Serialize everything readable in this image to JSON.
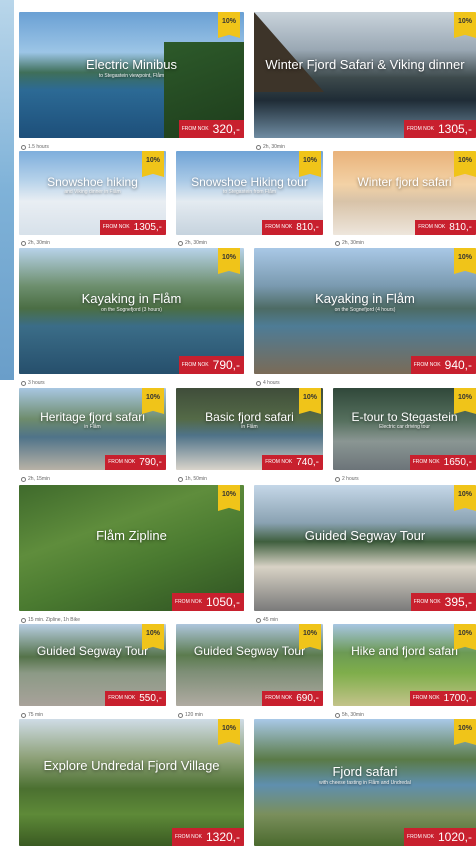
{
  "tiles": [
    {
      "title": "Electric Minibus",
      "subtitle": "to Stegastein viewpoint, Flåm",
      "badge": "10%",
      "from": "From NOK",
      "price": "320,-",
      "duration": "1.5 hours"
    },
    {
      "title": "Winter Fjord Safari & Viking dinner",
      "subtitle": "",
      "badge": "10%",
      "from": "From NOK",
      "price": "1305,-",
      "duration": "2h, 30min"
    },
    {
      "title": "Snowshoe hiking",
      "subtitle": "and Viking dinner in Flåm",
      "badge": "10%",
      "from": "From NOK",
      "price": "1305,-",
      "duration": "2h, 30min"
    },
    {
      "title": "Snowshoe Hiking tour",
      "subtitle": "to Stegastein from Flåm",
      "badge": "10%",
      "from": "From NOK",
      "price": "810,-",
      "duration": "2h, 30min"
    },
    {
      "title": "Winter fjord safari",
      "subtitle": "",
      "badge": "10%",
      "from": "From NOK",
      "price": "810,-",
      "duration": "2h, 30min"
    },
    {
      "title": "Kayaking in Flåm",
      "subtitle": "on the Sognefjord (3 hours)",
      "badge": "10%",
      "from": "From NOK",
      "price": "790,-",
      "duration": "3 hours"
    },
    {
      "title": "Kayaking in Flåm",
      "subtitle": "on the Sognefjord (4 hours)",
      "badge": "10%",
      "from": "From NOK",
      "price": "940,-",
      "duration": "4 hours"
    },
    {
      "title": "Heritage fjord safari",
      "subtitle": "in Flåm",
      "badge": "10%",
      "from": "From NOK",
      "price": "790,-",
      "duration": "2h, 15min"
    },
    {
      "title": "Basic fjord safari",
      "subtitle": "in Flåm",
      "badge": "10%",
      "from": "From NOK",
      "price": "740,-",
      "duration": "1h, 50min"
    },
    {
      "title": "E-tour to Stegastein",
      "subtitle": "Electric car driving tour",
      "badge": "10%",
      "from": "From NOK",
      "price": "1650,-",
      "duration": "2 hours"
    },
    {
      "title": "Flåm Zipline",
      "subtitle": "",
      "badge": "10%",
      "from": "From NOK",
      "price": "1050,-",
      "duration": "15 min. Zipline, 1h Bike"
    },
    {
      "title": "Guided Segway Tour",
      "subtitle": "",
      "badge": "10%",
      "from": "From NOK",
      "price": "395,-",
      "duration": "45 min"
    },
    {
      "title": "Guided Segway Tour",
      "subtitle": "",
      "badge": "10%",
      "from": "From NOK",
      "price": "550,-",
      "duration": "75 min"
    },
    {
      "title": "Guided Segway Tour",
      "subtitle": "",
      "badge": "10%",
      "from": "From NOK",
      "price": "690,-",
      "duration": "120 min"
    },
    {
      "title": "Hike and fjord safari",
      "subtitle": "",
      "badge": "10%",
      "from": "From NOK",
      "price": "1700,-",
      "duration": "5h, 30min"
    },
    {
      "title": "Explore Undredal Fjord Village",
      "subtitle": "",
      "badge": "10%",
      "from": "From NOK",
      "price": "1320,-",
      "duration": ""
    },
    {
      "title": "Fjord safari",
      "subtitle": "with cheese tasting in Flåm and Undredal",
      "badge": "10%",
      "from": "From NOK",
      "price": "1020,-",
      "duration": ""
    }
  ],
  "colors": {
    "badge": "#f0c419",
    "price": "#c8202e"
  }
}
